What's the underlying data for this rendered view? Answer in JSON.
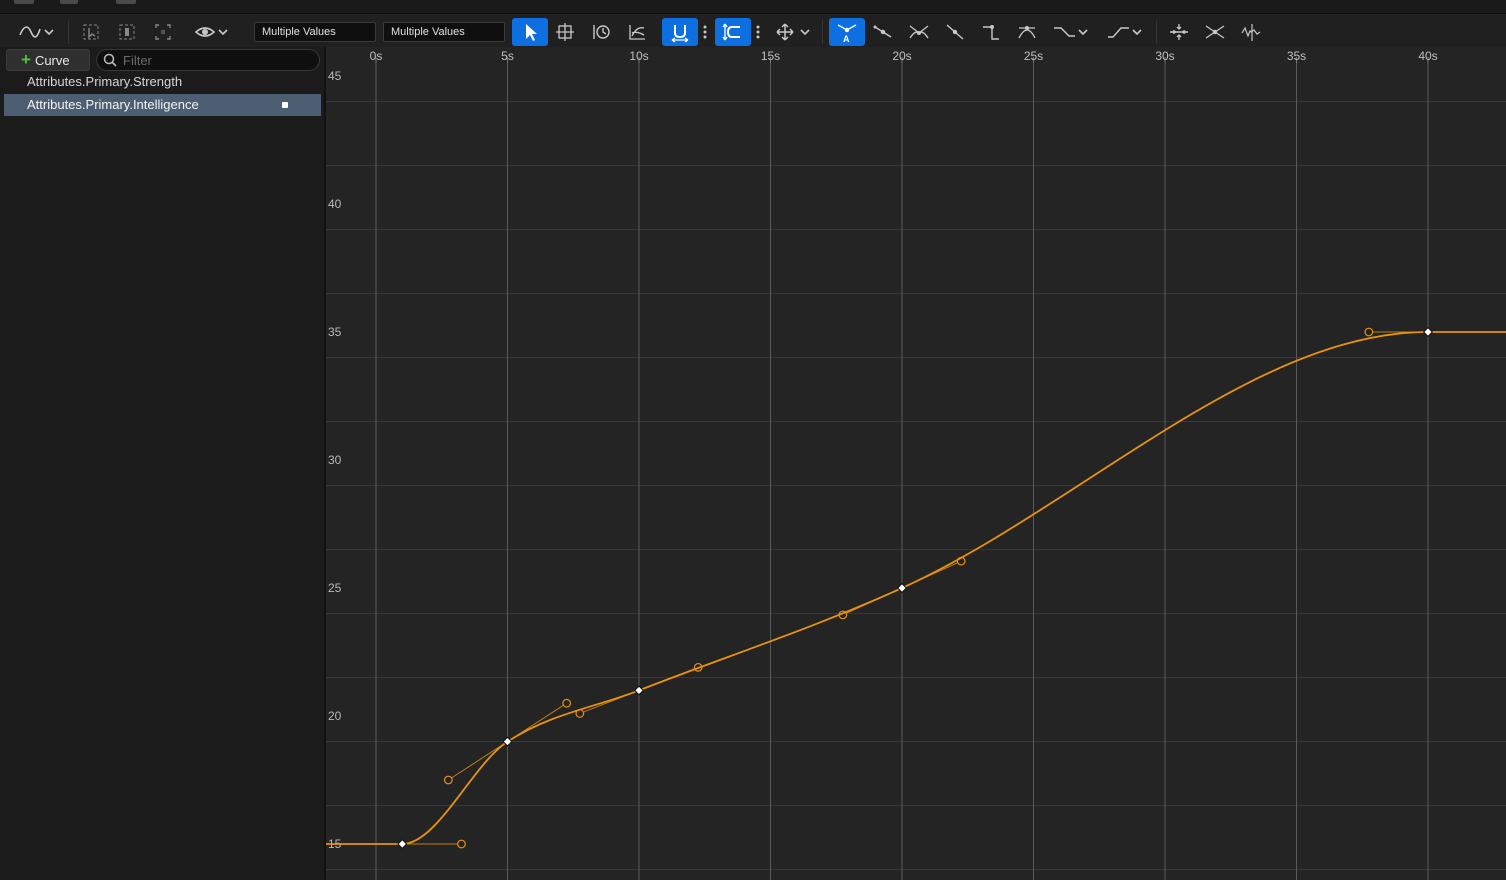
{
  "toolbar": {
    "time_value": "Multiple Values",
    "key_value": "Multiple Values",
    "icons": [
      "curve-view-icon",
      "select-keys-icon",
      "select-all-icon",
      "frame-selection-icon",
      "visibility-icon",
      "select-tool-icon",
      "transform-tool-icon",
      "retime-tool-icon",
      "multi-scale-tool-icon",
      "snap-time-icon",
      "snap-value-icon",
      "axis-snapping-icon",
      "auto-tangent-icon",
      "user-tangent-icon",
      "break-tangent-icon",
      "linear-tangent-icon",
      "constant-tangent-icon",
      "weighted-tangent-icon",
      "pre-infinity-icon",
      "post-infinity-icon",
      "flatten-icon",
      "straighten-icon",
      "filter-icon"
    ]
  },
  "sidebar": {
    "add_curve_label": "Curve",
    "filter_placeholder": "Filter",
    "curves": [
      {
        "name": "Attributes.Primary.Strength",
        "selected": false
      },
      {
        "name": "Attributes.Primary.Intelligence",
        "selected": true
      }
    ]
  },
  "graph": {
    "x_ticks": [
      "0s",
      "5s",
      "10s",
      "15s",
      "20s",
      "25s",
      "30s",
      "35s",
      "40s"
    ],
    "y_ticks": [
      "15",
      "20",
      "25",
      "30",
      "35",
      "40",
      "45"
    ],
    "curve_color": "#e8920e",
    "keys": [
      {
        "time": 1,
        "value": 15
      },
      {
        "time": 5,
        "value": 19
      },
      {
        "time": 10,
        "value": 21
      },
      {
        "time": 20,
        "value": 25
      },
      {
        "time": 40,
        "value": 35
      }
    ]
  }
}
